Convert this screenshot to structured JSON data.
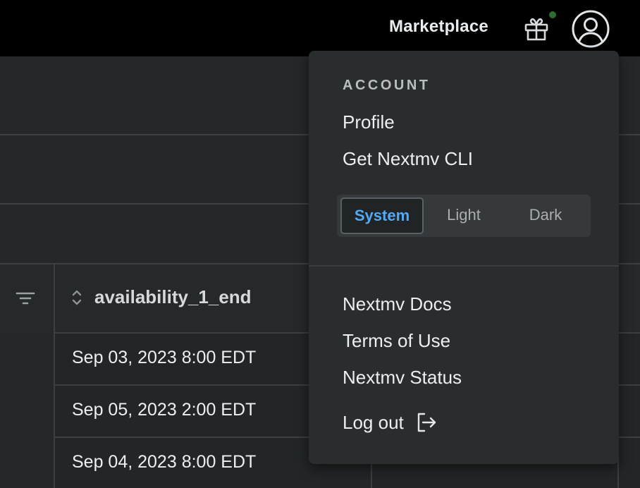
{
  "topbar": {
    "marketplace_label": "Marketplace",
    "gift_icon": "gift-icon",
    "avatar_icon": "user-circle-icon",
    "notification_dot_color": "#2e6b33"
  },
  "table": {
    "column_title": "availability_1_end",
    "rows": [
      "Sep 03, 2023 8:00 EDT",
      "Sep 05, 2023 2:00 EDT",
      "Sep 04, 2023 8:00 EDT"
    ]
  },
  "menu": {
    "heading": "ACCOUNT",
    "profile_label": "Profile",
    "cli_label": "Get Nextmv CLI",
    "theme": {
      "options": [
        "System",
        "Light",
        "Dark"
      ],
      "selected": "System",
      "accent_color": "#55a9f2"
    },
    "docs_label": "Nextmv Docs",
    "terms_label": "Terms of Use",
    "status_label": "Nextmv Status",
    "logout_label": "Log out"
  }
}
